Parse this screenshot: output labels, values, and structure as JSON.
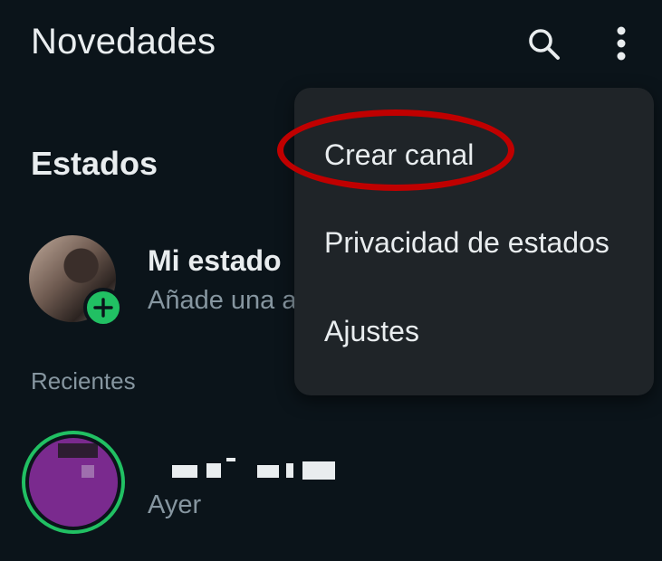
{
  "header": {
    "title": "Novedades",
    "search_icon": "search-icon",
    "more_icon": "more-vert-icon"
  },
  "status_section": {
    "title": "Estados",
    "my_status": {
      "name": "Mi estado",
      "subtitle": "Añade una a",
      "add_icon": "plus-icon"
    },
    "recent_label": "Recientes",
    "contacts": [
      {
        "name": "",
        "time": "Ayer"
      }
    ]
  },
  "overflow_menu": {
    "items": [
      {
        "label": "Crear canal"
      },
      {
        "label": "Privacidad de estados"
      },
      {
        "label": "Ajustes"
      }
    ],
    "highlighted_item": "Crear canal"
  },
  "colors": {
    "background": "#0b141a",
    "menu_background": "#1f2428",
    "accent_green": "#21c063",
    "annotation_red": "#c00000",
    "secondary_text": "#8696a0"
  }
}
